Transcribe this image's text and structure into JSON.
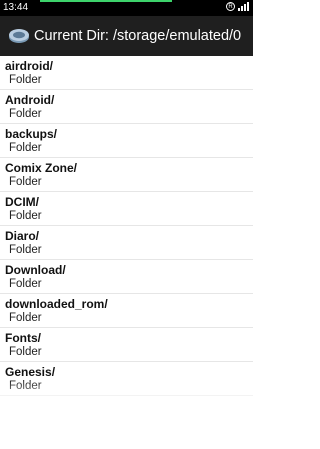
{
  "status_bar": {
    "time": "13:44",
    "icons": [
      "alarm-icon",
      "signal-icon"
    ]
  },
  "action_bar": {
    "title": "Current Dir: /storage/emulated/0",
    "icon": "drive-icon"
  },
  "entries": [
    {
      "name": "airdroid/",
      "kind": "Folder"
    },
    {
      "name": "Android/",
      "kind": "Folder"
    },
    {
      "name": "backups/",
      "kind": "Folder"
    },
    {
      "name": "Comix Zone/",
      "kind": "Folder"
    },
    {
      "name": "DCIM/",
      "kind": "Folder"
    },
    {
      "name": "Diaro/",
      "kind": "Folder"
    },
    {
      "name": "Download/",
      "kind": "Folder"
    },
    {
      "name": "downloaded_rom/",
      "kind": "Folder"
    },
    {
      "name": "Fonts/",
      "kind": "Folder"
    },
    {
      "name": "Genesis/",
      "kind": "Folder"
    }
  ]
}
